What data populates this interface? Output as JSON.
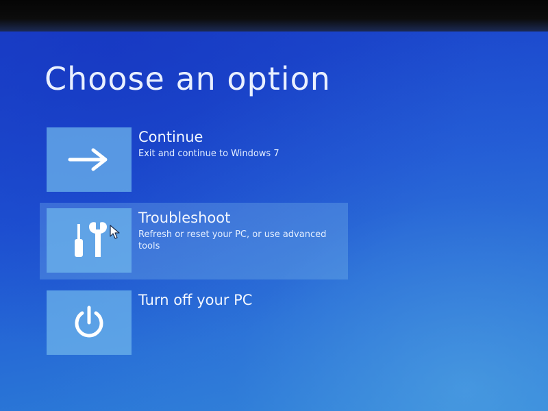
{
  "title": "Choose an option",
  "options": [
    {
      "title": "Continue",
      "description": "Exit and continue to Windows 7",
      "icon": "arrow-right-icon"
    },
    {
      "title": "Troubleshoot",
      "description": "Refresh or reset your PC, or use advanced tools",
      "icon": "tools-icon",
      "state": "hovered"
    },
    {
      "title": "Turn off your PC",
      "description": "",
      "icon": "power-icon"
    }
  ],
  "colors": {
    "background": "#1f55d4",
    "tile": "#6eb4eb",
    "text": "#ffffff"
  }
}
